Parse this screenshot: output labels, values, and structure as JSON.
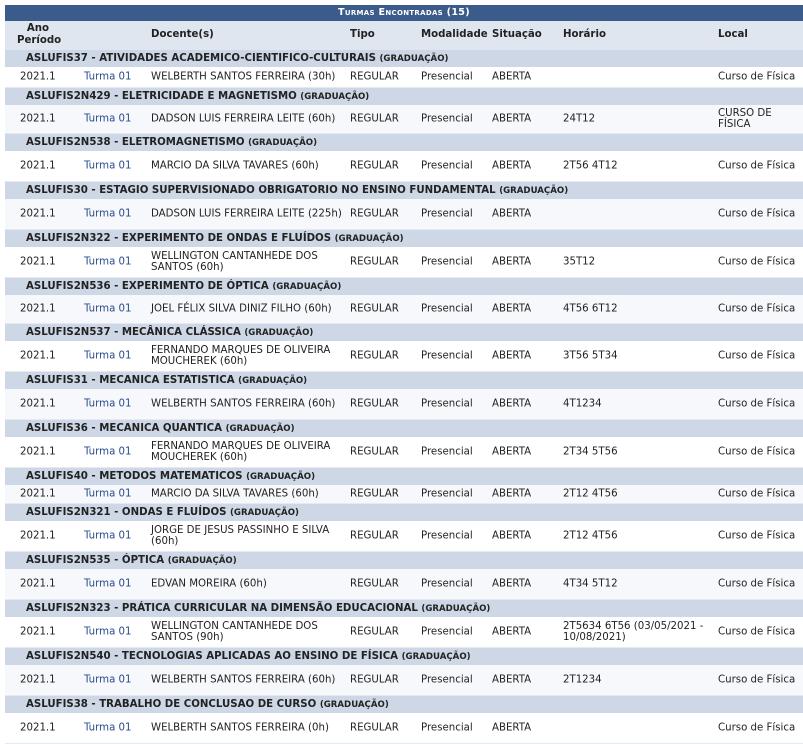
{
  "caption": "Turmas Encontradas (15)",
  "headers": {
    "ano": "Ano Período",
    "docente": "Docente(s)",
    "tipo": "Tipo",
    "modalidade": "Modalidade",
    "situacao": "Situação",
    "horario": "Horário",
    "local": "Local"
  },
  "groups": [
    {
      "code": "ASLUFIS37",
      "title": "ATIVIDADES ACADEMICO-CIENTIFICO-CULTURAIS",
      "level": "(GRADUAÇÃO)",
      "row": {
        "ano": "2021.1",
        "turma": "Turma 01",
        "docente": "WELBERTH SANTOS FERREIRA (30h)",
        "tipo": "REGULAR",
        "modalidade": "Presencial",
        "situacao": "ABERTA",
        "horario": "",
        "local": "Curso de Física"
      }
    },
    {
      "code": "ASLUFIS2N429",
      "title": "ELETRICIDADE E MAGNETISMO",
      "level": "(GRADUAÇÃO)",
      "row": {
        "ano": "2021.1",
        "turma": "Turma 01",
        "docente": "DADSON LUIS FERREIRA LEITE (60h)",
        "tipo": "REGULAR",
        "modalidade": "Presencial",
        "situacao": "ABERTA",
        "horario": "24T12",
        "local": "CURSO DE FÍSICA"
      }
    },
    {
      "code": "ASLUFIS2N538",
      "title": "ELETROMAGNETISMO",
      "level": "(GRADUAÇÃO)",
      "row": {
        "ano": "2021.1",
        "turma": "Turma 01",
        "docente": "MARCIO DA SILVA TAVARES (60h)",
        "tipo": "REGULAR",
        "modalidade": "Presencial",
        "situacao": "ABERTA",
        "horario": "2T56 4T12",
        "local": "Curso de Física"
      }
    },
    {
      "code": "ASLUFIS30",
      "title": "ESTAGIO SUPERVISIONADO OBRIGATORIO NO ENSINO FUNDAMENTAL",
      "level": "(GRADUAÇÃO)",
      "row": {
        "ano": "2021.1",
        "turma": "Turma 01",
        "docente": "DADSON LUIS FERREIRA LEITE (225h)",
        "tipo": "REGULAR",
        "modalidade": "Presencial",
        "situacao": "ABERTA",
        "horario": "",
        "local": "Curso de Física"
      }
    },
    {
      "code": "ASLUFIS2N322",
      "title": "EXPERIMENTO DE ONDAS E FLUÍDOS",
      "level": "(GRADUAÇÃO)",
      "row": {
        "ano": "2021.1",
        "turma": "Turma 01",
        "docente": "WELLINGTON CANTANHEDE DOS SANTOS (60h)",
        "tipo": "REGULAR",
        "modalidade": "Presencial",
        "situacao": "ABERTA",
        "horario": "35T12",
        "local": "Curso de Física"
      }
    },
    {
      "code": "ASLUFIS2N536",
      "title": "EXPERIMENTO DE ÓPTICA",
      "level": "(GRADUAÇÃO)",
      "row": {
        "ano": "2021.1",
        "turma": "Turma 01",
        "docente": "JOEL FÉLIX SILVA DINIZ FILHO (60h)",
        "tipo": "REGULAR",
        "modalidade": "Presencial",
        "situacao": "ABERTA",
        "horario": "4T56 6T12",
        "local": "Curso de Física"
      }
    },
    {
      "code": "ASLUFIS2N537",
      "title": "MECÂNICA CLÁSSICA",
      "level": "(GRADUAÇÃO)",
      "row": {
        "ano": "2021.1",
        "turma": "Turma 01",
        "docente": "FERNANDO MARQUES DE OLIVEIRA MOUCHEREK (60h)",
        "tipo": "REGULAR",
        "modalidade": "Presencial",
        "situacao": "ABERTA",
        "horario": "3T56 5T34",
        "local": "Curso de Física"
      }
    },
    {
      "code": "ASLUFIS31",
      "title": "MECANICA ESTATISTICA",
      "level": "(GRADUAÇÃO)",
      "row": {
        "ano": "2021.1",
        "turma": "Turma 01",
        "docente": "WELBERTH SANTOS FERREIRA (60h)",
        "tipo": "REGULAR",
        "modalidade": "Presencial",
        "situacao": "ABERTA",
        "horario": "4T1234",
        "local": "Curso de Física"
      }
    },
    {
      "code": "ASLUFIS36",
      "title": "MECANICA QUANTICA",
      "level": "(GRADUAÇÃO)",
      "row": {
        "ano": "2021.1",
        "turma": "Turma 01",
        "docente": "FERNANDO MARQUES DE OLIVEIRA MOUCHEREK (60h)",
        "tipo": "REGULAR",
        "modalidade": "Presencial",
        "situacao": "ABERTA",
        "horario": "2T34 5T56",
        "local": "Curso de Física"
      }
    },
    {
      "code": "ASLUFIS40",
      "title": "METODOS MATEMATICOS",
      "level": "(GRADUAÇÃO)",
      "row": {
        "ano": "2021.1",
        "turma": "Turma 01",
        "docente": "MARCIO DA SILVA TAVARES (60h)",
        "tipo": "REGULAR",
        "modalidade": "Presencial",
        "situacao": "ABERTA",
        "horario": "2T12 4T56",
        "local": "Curso de Física"
      }
    },
    {
      "code": "ASLUFIS2N321",
      "title": "ONDAS E FLUÍDOS",
      "level": "(GRADUAÇÃO)",
      "row": {
        "ano": "2021.1",
        "turma": "Turma 01",
        "docente": "JORGE DE JESUS PASSINHO E SILVA (60h)",
        "tipo": "REGULAR",
        "modalidade": "Presencial",
        "situacao": "ABERTA",
        "horario": "2T12 4T56",
        "local": "Curso de Física"
      }
    },
    {
      "code": "ASLUFIS2N535",
      "title": "ÓPTICA",
      "level": "(GRADUAÇÃO)",
      "row": {
        "ano": "2021.1",
        "turma": "Turma 01",
        "docente": "EDVAN MOREIRA (60h)",
        "tipo": "REGULAR",
        "modalidade": "Presencial",
        "situacao": "ABERTA",
        "horario": "4T34 5T12",
        "local": "Curso de Física"
      }
    },
    {
      "code": "ASLUFIS2N323",
      "title": "PRÁTICA CURRICULAR NA DIMENSÃO EDUCACIONAL",
      "level": "(GRADUAÇÃO)",
      "row": {
        "ano": "2021.1",
        "turma": "Turma 01",
        "docente": "WELLINGTON CANTANHEDE DOS SANTOS (90h)",
        "tipo": "REGULAR",
        "modalidade": "Presencial",
        "situacao": "ABERTA",
        "horario": "2T5634 6T56 (03/05/2021 - 10/08/2021)",
        "local": "Curso de Física"
      }
    },
    {
      "code": "ASLUFIS2N540",
      "title": "TECNOLOGIAS APLICADAS AO ENSINO DE FÍSICA",
      "level": "(GRADUAÇÃO)",
      "row": {
        "ano": "2021.1",
        "turma": "Turma 01",
        "docente": "WELBERTH SANTOS FERREIRA (60h)",
        "tipo": "REGULAR",
        "modalidade": "Presencial",
        "situacao": "ABERTA",
        "horario": "2T1234",
        "local": "Curso de Física"
      }
    },
    {
      "code": "ASLUFIS38",
      "title": "TRABALHO DE CONCLUSAO DE CURSO",
      "level": "(GRADUAÇÃO)",
      "row": {
        "ano": "2021.1",
        "turma": "Turma 01",
        "docente": "WELBERTH SANTOS FERREIRA (0h)",
        "tipo": "REGULAR",
        "modalidade": "Presencial",
        "situacao": "ABERTA",
        "horario": "",
        "local": "Curso de Física"
      }
    }
  ]
}
